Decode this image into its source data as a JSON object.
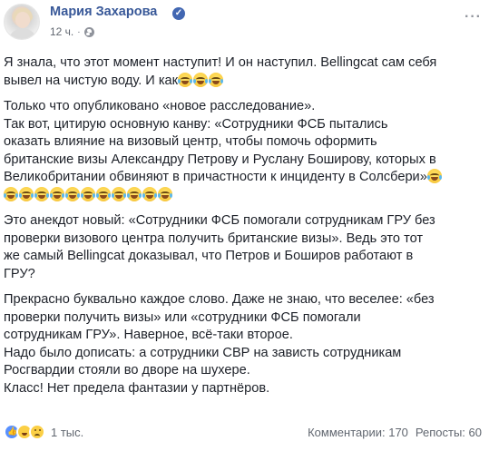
{
  "author": {
    "name": "Мария Захарова",
    "verified_mark": "✓",
    "timestamp": "12 ч.",
    "audience_icon": "globe-icon",
    "more_label": "···"
  },
  "post": {
    "paragraphs": [
      {
        "lines": [
          "Я знала, что этот момент наступит! И он наступил. Bellingcat сам себя",
          "вывел на чистую воду. И как"
        ],
        "trailing_emojis": 3
      },
      {
        "lines": [
          "Только что опубликовано «новое расследование».",
          "Так вот, цитирую основную канву: «Сотрудники ФСБ пытались",
          "оказать влияние на визовый центр, чтобы помочь оформить",
          "британские визы Александру Петрову и Руслану Боширову, которых в",
          "Великобритании обвиняют в причастности к инциденту в Солсбери»"
        ],
        "trailing_emojis": 1,
        "emoji_row": 11
      },
      {
        "lines": [
          "Это анекдот новый: «Сотрудники ФСБ помогали сотрудникам ГРУ без",
          "проверки визового центра получить британские визы». Ведь это тот",
          "же самый Bellingcat доказывал, что Петров и Боширов работают в",
          "ГРУ?"
        ]
      },
      {
        "lines": [
          "Прекрасно буквально каждое слово. Даже не знаю, что веселее: «без",
          "проверки получить визы» или «сотрудники ФСБ помогали",
          "сотрудникам ГРУ». Наверное, всё-таки второе.",
          "Надо было дописать: а сотрудники СВР на зависть сотрудникам",
          "Росгвардии стояли во дворе на шухере.",
          "Класс! Нет предела фантазии у партнёров."
        ]
      }
    ]
  },
  "footer": {
    "reaction_icons": [
      "like-icon",
      "haha-icon",
      "sad-icon"
    ],
    "reaction_count": "1 тыс.",
    "comments": "Комментарии: 170",
    "shares": "Репосты: 60"
  },
  "colors": {
    "author_link": "#385898",
    "text": "#1d2129",
    "meta": "#616770",
    "like": "#5890ff"
  }
}
